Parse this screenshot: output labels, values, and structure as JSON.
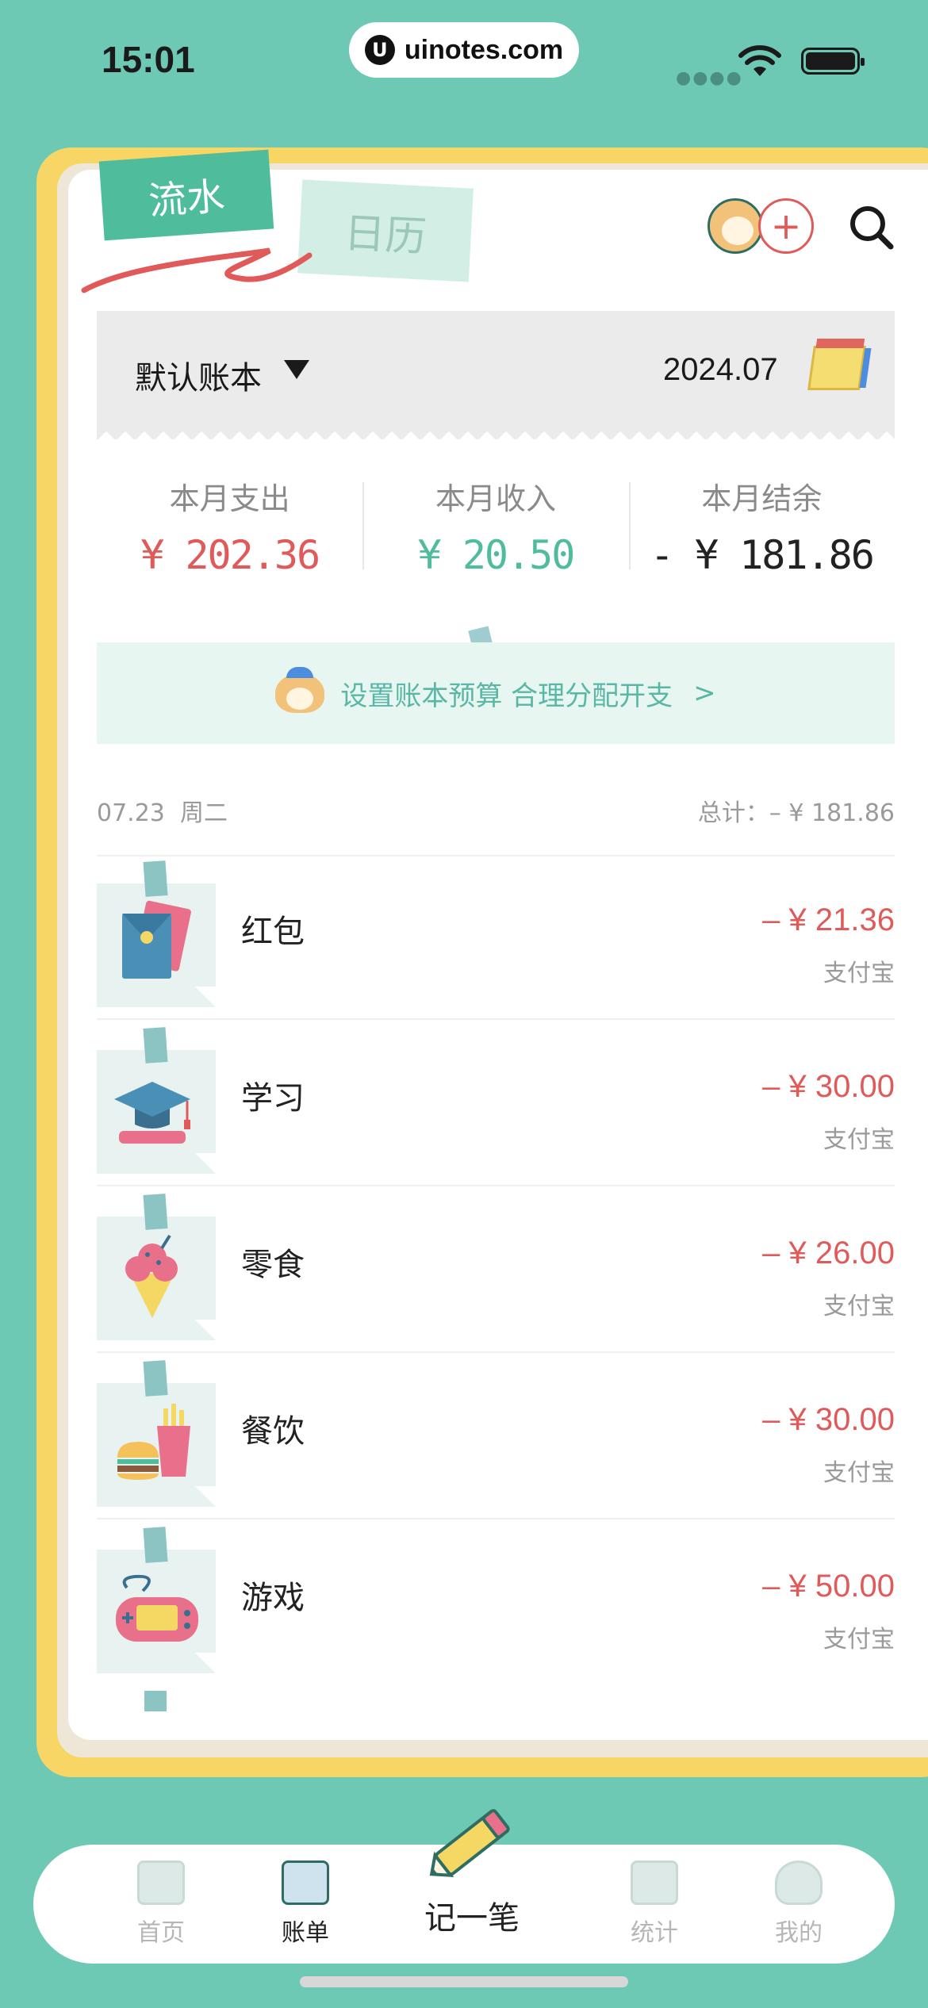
{
  "status_bar": {
    "time": "15:01",
    "url": "uinotes.com",
    "url_logo": "U"
  },
  "tabs": {
    "active": "流水",
    "inactive": "日历"
  },
  "header_icons": {
    "avatar": "dog-avatar-icon",
    "add": "+",
    "search": "search-icon"
  },
  "ledger": {
    "name": "默认账本",
    "month": "2024.07"
  },
  "summary": [
    {
      "label": "本月支出",
      "value": "¥ 202.36",
      "color": "#e05a5a"
    },
    {
      "label": "本月收入",
      "value": "¥ 20.50",
      "color": "#4fbd9c"
    },
    {
      "label": "本月结余",
      "value": "- ¥ 181.86",
      "color": "#222222"
    }
  ],
  "banner": {
    "text": "设置账本预算 合理分配开支",
    "arrow": ">"
  },
  "day_group": {
    "date": "07.23",
    "weekday": "周二",
    "total": "总计：– ¥ 181.86"
  },
  "transactions": [
    {
      "name": "红包",
      "amount": "– ¥ 21.36",
      "method": "支付宝",
      "icon": "red-envelope-icon"
    },
    {
      "name": "学习",
      "amount": "– ¥ 30.00",
      "method": "支付宝",
      "icon": "graduation-cap-icon"
    },
    {
      "name": "零食",
      "amount": "– ¥ 26.00",
      "method": "支付宝",
      "icon": "ice-cream-icon"
    },
    {
      "name": "餐饮",
      "amount": "– ¥ 30.00",
      "method": "支付宝",
      "icon": "burger-fries-icon"
    },
    {
      "name": "游戏",
      "amount": "– ¥ 50.00",
      "method": "支付宝",
      "icon": "gamepad-icon"
    }
  ],
  "tabbar": {
    "home": "首页",
    "bill": "账单",
    "record": "记一笔",
    "stats": "统计",
    "mine": "我的"
  },
  "colors": {
    "background": "#6dc9b4",
    "frame": "#f7d665",
    "expense": "#e05a5a",
    "income": "#4fbd9c",
    "tab_active": "#4fbd9c"
  }
}
